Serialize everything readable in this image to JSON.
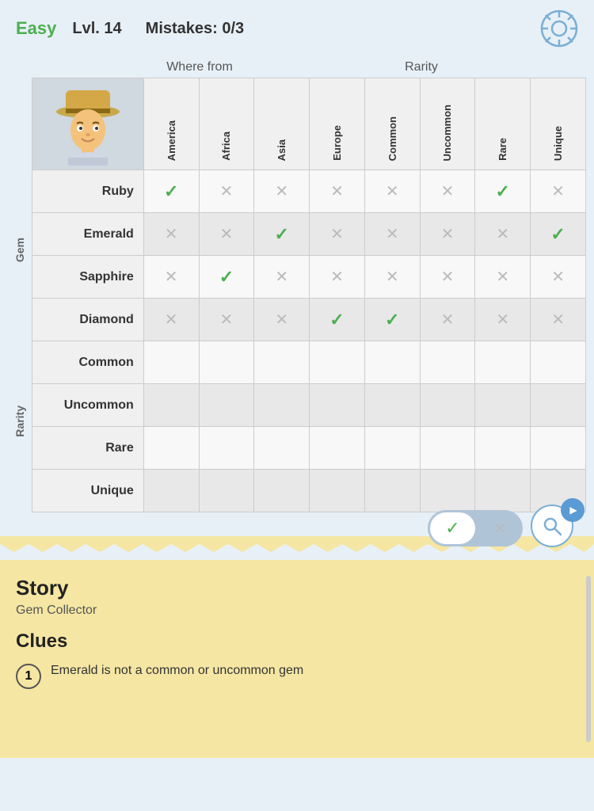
{
  "header": {
    "difficulty": "Easy",
    "level_label": "Lvl. 14",
    "mistakes_label": "Mistakes: 0/3"
  },
  "top_categories": {
    "where_from": "Where from",
    "rarity": "Rarity"
  },
  "columns": [
    {
      "id": "america",
      "label": "America"
    },
    {
      "id": "africa",
      "label": "Africa"
    },
    {
      "id": "asia",
      "label": "Asia"
    },
    {
      "id": "europe",
      "label": "Europe"
    },
    {
      "id": "common",
      "label": "Common"
    },
    {
      "id": "uncommon",
      "label": "Uncommon"
    },
    {
      "id": "rare",
      "label": "Rare"
    },
    {
      "id": "unique",
      "label": "Unique"
    }
  ],
  "row_groups": [
    {
      "group_label": "Gem",
      "rows": [
        {
          "name": "Ruby",
          "cells": [
            "check",
            "cross",
            "cross",
            "cross",
            "cross",
            "cross",
            "check",
            "cross"
          ]
        },
        {
          "name": "Emerald",
          "cells": [
            "cross",
            "cross",
            "check",
            "cross",
            "cross",
            "cross",
            "cross",
            "check"
          ]
        },
        {
          "name": "Sapphire",
          "cells": [
            "cross",
            "check",
            "cross",
            "cross",
            "cross",
            "cross",
            "cross",
            "cross"
          ]
        },
        {
          "name": "Diamond",
          "cells": [
            "cross",
            "cross",
            "cross",
            "check",
            "check",
            "cross",
            "cross",
            "cross"
          ]
        }
      ]
    },
    {
      "group_label": "Rarity",
      "rows": [
        {
          "name": "Common",
          "cells": [
            "",
            "",
            "",
            "",
            "",
            "",
            "",
            ""
          ]
        },
        {
          "name": "Uncommon",
          "cells": [
            "",
            "",
            "",
            "",
            "",
            "",
            "",
            ""
          ]
        },
        {
          "name": "Rare",
          "cells": [
            "",
            "",
            "",
            "",
            "",
            "",
            "",
            ""
          ]
        },
        {
          "name": "Unique",
          "cells": [
            "",
            "",
            "",
            "",
            "",
            "",
            "",
            ""
          ]
        }
      ]
    }
  ],
  "action_buttons": {
    "confirm_icon": "✓",
    "deny_icon": "✕",
    "magnify_icon": "🔍",
    "play_icon": "▶"
  },
  "story": {
    "title": "Story",
    "subtitle": "Gem Collector",
    "clues_title": "Clues",
    "clues": [
      {
        "number": 1,
        "text": "Emerald is not a common or uncommon gem"
      }
    ]
  }
}
